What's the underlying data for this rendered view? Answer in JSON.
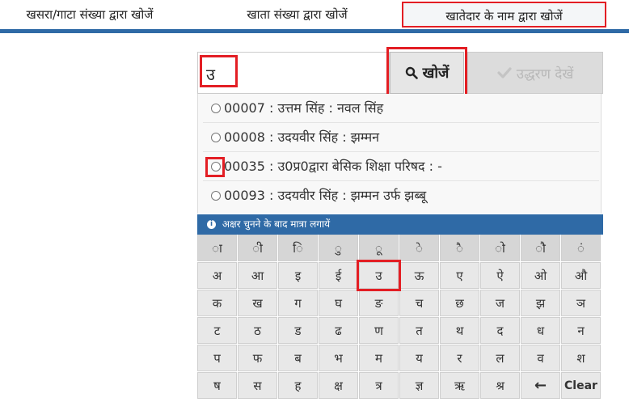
{
  "tabs": [
    {
      "label": "खसरा/गाटा संख्या द्वारा खोजें"
    },
    {
      "label": "खाता संख्या द्वारा खोजें"
    },
    {
      "label": "खातेदार के नाम द्वारा खोजें"
    }
  ],
  "search": {
    "value": "उ",
    "button": "खोजें",
    "view_button": "उद्धरण देखें"
  },
  "results": [
    {
      "text": "00007 : उत्तम सिंह : नवल सिंह"
    },
    {
      "text": "00008 : उदयवीर सिंह : झम्मन"
    },
    {
      "text": "00035 : उ0प्र0द्वारा बेसिक शिक्षा परिषद : -"
    },
    {
      "text": "00093 : उदयवीर सिंह : झम्मन उर्फ झब्बू"
    }
  ],
  "keyboard": {
    "hint": "अक्षर चुनने के बाद मात्रा लगायें",
    "rows": [
      [
        "ा",
        "ी",
        "ि",
        "ु",
        "ू",
        "े",
        "ै",
        "ो",
        "ौ",
        "ं"
      ],
      [
        "अ",
        "आ",
        "इ",
        "ई",
        "उ",
        "ऊ",
        "ए",
        "ऐ",
        "ओ",
        "औ"
      ],
      [
        "क",
        "ख",
        "ग",
        "घ",
        "ङ",
        "च",
        "छ",
        "ज",
        "झ",
        "ञ"
      ],
      [
        "ट",
        "ठ",
        "ड",
        "ढ",
        "ण",
        "त",
        "थ",
        "द",
        "ध",
        "न"
      ],
      [
        "प",
        "फ",
        "ब",
        "भ",
        "म",
        "य",
        "र",
        "ल",
        "व",
        "श"
      ],
      [
        "ष",
        "स",
        "ह",
        "क्ष",
        "त्र",
        "ज्ञ",
        "ऋ",
        "श्र",
        "←",
        "Clear"
      ]
    ]
  },
  "colors": {
    "accent_blue": "#2f6aa6",
    "highlight_red": "#e31e24"
  }
}
